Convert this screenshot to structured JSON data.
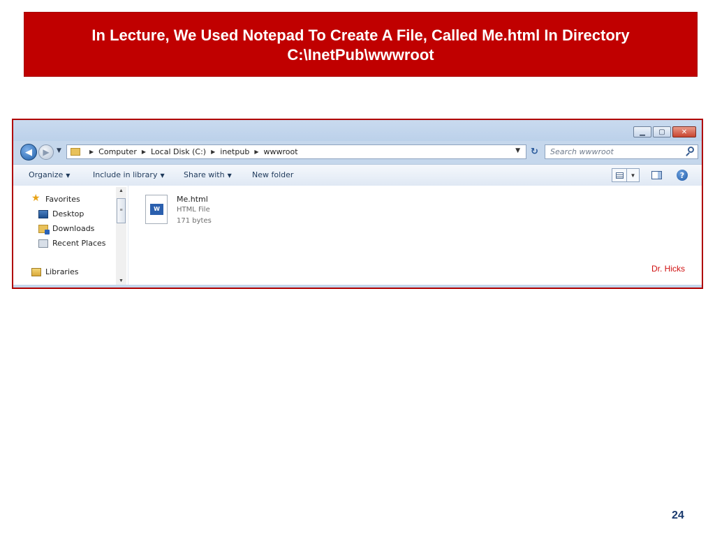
{
  "slide": {
    "title_line1": "In Lecture, We Used Notepad To Create A File, Called Me.html In Directory",
    "title_line2": "C:\\InetPub\\wwwroot",
    "page_number": "24",
    "accent_color": "#c00000"
  },
  "window": {
    "minimize_icon": "minimize-icon",
    "maximize_icon": "maximize-icon",
    "close_icon": "close-icon"
  },
  "address": {
    "crumbs": [
      "Computer",
      "Local Disk (C:)",
      "inetpub",
      "wwwroot"
    ],
    "search_placeholder": "Search wwwroot"
  },
  "toolbar": {
    "organize": "Organize",
    "include_library": "Include in library",
    "share_with": "Share with",
    "new_folder": "New folder"
  },
  "navpane": {
    "favorites": "Favorites",
    "desktop": "Desktop",
    "downloads": "Downloads",
    "recent_places": "Recent Places",
    "libraries": "Libraries"
  },
  "file": {
    "name": "Me.html",
    "type": "HTML File",
    "size": "171 bytes",
    "icon_label": "W"
  },
  "watermark": "Dr. Hicks"
}
